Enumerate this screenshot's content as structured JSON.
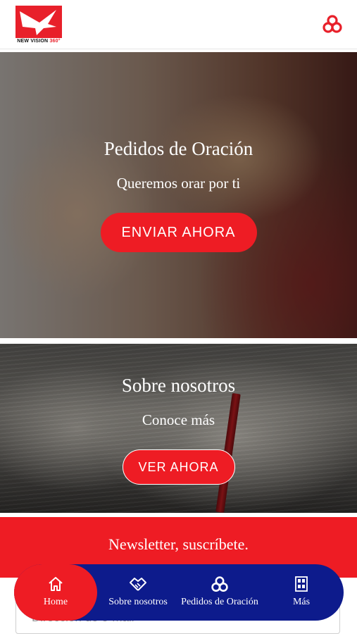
{
  "header": {
    "logo_text": "NEW VISION",
    "logo_sup": "360°",
    "right_icon": "trinity-knot-icon"
  },
  "hero_prayer": {
    "title": "Pedidos de Oración",
    "subtitle": "Queremos orar por ti",
    "button_label": "ENVIAR AHORA"
  },
  "hero_about": {
    "title": "Sobre nosotros",
    "subtitle": "Conoce más",
    "button_label": "VER AHORA"
  },
  "newsletter": {
    "title": "Newsletter, suscríbete.",
    "email_placeholder": "Dirección de e-mail"
  },
  "bottom_nav": {
    "items": [
      {
        "label": "Home",
        "icon": "home-icon",
        "active": true
      },
      {
        "label": "Sobre nosotros",
        "icon": "handshake-icon",
        "active": false
      },
      {
        "label": "Pedidos de Oración",
        "icon": "trinity-knot-icon",
        "active": false
      },
      {
        "label": "Más",
        "icon": "grid-icon",
        "active": false
      }
    ]
  },
  "colors": {
    "brand_red": "#ee1c24",
    "nav_blue": "#0d1b8c"
  }
}
